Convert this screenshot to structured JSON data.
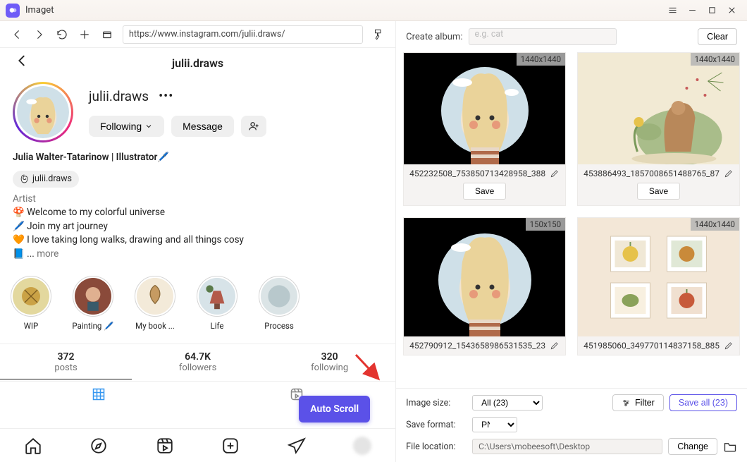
{
  "app": {
    "title": "Imaget"
  },
  "toolbar": {
    "url": "https://www.instagram.com/julii.draws/"
  },
  "ig": {
    "topname": "julii.draws",
    "username": "julii.draws",
    "full_name": "Julia Walter-Tatarinow | Illustrator🖊️",
    "threads_handle": "julii.draws",
    "category": "Artist",
    "bio_lines": {
      "l1": "🍄 Welcome to my colorful universe",
      "l2": "🖊️ Join my art journey",
      "l3": "🧡 I love taking long walks, drawing and all things cosy",
      "l4_prefix": "📘  ... ",
      "more": "more"
    },
    "buttons": {
      "following": "Following",
      "message": "Message"
    },
    "stories": {
      "s0": "WIP",
      "s1": "Painting 🖊️",
      "s2": "My book ...",
      "s3": "Life",
      "s4": "Process"
    },
    "stats": {
      "posts_n": "372",
      "posts_l": "posts",
      "followers_n": "64.7K",
      "followers_l": "followers",
      "following_n": "320",
      "following_l": "following"
    },
    "auto_scroll": "Auto Scroll"
  },
  "right": {
    "create_album_label": "Create album:",
    "album_placeholder": "e.g. cat",
    "clear_btn": "Clear",
    "cards": {
      "c0": {
        "dim": "1440x1440",
        "name": "452232508_753850713428958_388",
        "save": "Save"
      },
      "c1": {
        "dim": "1440x1440",
        "name": "453886493_1857008651488765_87",
        "save": "Save"
      },
      "c2": {
        "dim": "150x150",
        "name": "452790912_1543658986531535_23"
      },
      "c3": {
        "dim": "1440x1440",
        "name": "451985060_349770114837158_885"
      }
    },
    "image_size_label": "Image size:",
    "image_size_value": "All (23)",
    "filter_btn": "Filter",
    "save_all_btn": "Save all (23)",
    "save_format_label": "Save format:",
    "save_format_value": "PNG",
    "file_location_label": "File location:",
    "file_location_value": "C:\\Users\\mobeesoft\\Desktop",
    "change_btn": "Change"
  }
}
